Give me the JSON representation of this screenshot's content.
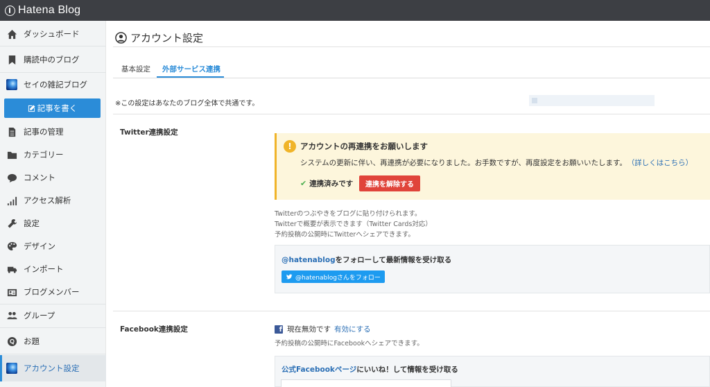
{
  "app": {
    "logo_text": "Hatena Blog"
  },
  "sidebar": {
    "items": [
      {
        "label": "ダッシュボード",
        "icon": "home-icon"
      },
      {
        "label": "購読中のブログ",
        "icon": "bookmark-icon"
      },
      {
        "label": "セイの雑記ブログ",
        "icon": "blog-avatar-icon"
      },
      {
        "label": "記事を書く",
        "icon": "edit-icon"
      },
      {
        "label": "記事の管理",
        "icon": "document-icon"
      },
      {
        "label": "カテゴリー",
        "icon": "folder-icon"
      },
      {
        "label": "コメント",
        "icon": "comment-icon"
      },
      {
        "label": "アクセス解析",
        "icon": "bar-chart-icon"
      },
      {
        "label": "設定",
        "icon": "wrench-icon"
      },
      {
        "label": "デザイン",
        "icon": "palette-icon"
      },
      {
        "label": "インポート",
        "icon": "truck-icon"
      },
      {
        "label": "ブログメンバー",
        "icon": "id-card-icon"
      },
      {
        "label": "グループ",
        "icon": "group-icon"
      },
      {
        "label": "お題",
        "icon": "q-icon"
      },
      {
        "label": "アカウント設定",
        "icon": "account-avatar-icon"
      }
    ]
  },
  "main": {
    "title": "アカウント設定",
    "tabs": [
      {
        "label": "基本設定",
        "active": false
      },
      {
        "label": "外部サービス連携",
        "active": true
      }
    ],
    "note": "※この設定はあなたのブログ全体で共通です。",
    "twitter": {
      "section_label": "Twitter連携設定",
      "alert_title": "アカウントの再連携をお願いします",
      "alert_body": "システムの更新に伴い、再連携が必要になりました。お手数ですが、再度設定をお願いいたします。",
      "alert_link": "（詳しくはこちら）",
      "connected_label": "連携済みです",
      "disconnect_label": "連携を解除する",
      "desc": [
        "Twitterのつぶやきをブログに貼り付けられます。",
        "Twitterで概要が表示できます（Twitter Cards対応）",
        "予約投稿の公開時にTwitterへシェアできます。"
      ],
      "follow_account": "@hatenablog",
      "follow_text": "をフォローして最新情報を受け取る",
      "follow_button": "@hatenablogさんをフォロー"
    },
    "facebook": {
      "section_label": "Facebook連携設定",
      "status": "現在無効です",
      "enable_label": "有効にする",
      "desc": "予約投稿の公開時にFacebookへシェアできます。",
      "box_link": "公式Facebookページ",
      "box_text": "にいいね！して情報を受け取る"
    }
  },
  "colors": {
    "accent": "#2b8cd8",
    "danger": "#e0443a",
    "alert_bg": "#fdf6dc",
    "alert_border": "#f0b429",
    "topbar": "#3d3f44"
  }
}
